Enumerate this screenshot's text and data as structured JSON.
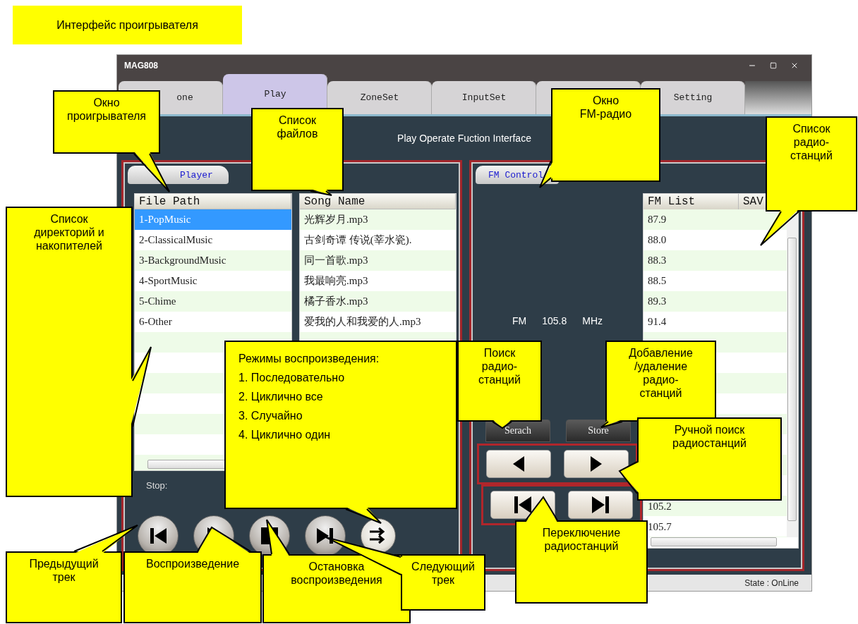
{
  "caption": "Интерфейс проигрывателя",
  "window": {
    "title": "MAG808"
  },
  "tabs": [
    {
      "label": "one",
      "selected": false
    },
    {
      "label": "Play",
      "selected": true
    },
    {
      "label": "ZoneSet",
      "selected": false
    },
    {
      "label": "InputSet",
      "selected": false
    },
    {
      "selected": false
    },
    {
      "label": "Setting",
      "selected": false
    }
  ],
  "page_title": "Play Operate Fuction Interface",
  "player": {
    "tab": "Player",
    "folders": {
      "header": "File Path",
      "items": [
        {
          "label": "1-PopMusic",
          "selected": true
        },
        {
          "label": "2-ClassicalMusic",
          "selected": false
        },
        {
          "label": "3-BackgroundMusic",
          "selected": false
        },
        {
          "label": "4-SportMusic",
          "selected": false
        },
        {
          "label": "5-Chime",
          "selected": false
        },
        {
          "label": "6-Other",
          "selected": false
        }
      ]
    },
    "songs": {
      "header": "Song Name",
      "items": [
        "光辉岁月.mp3",
        "古剑奇谭 传说(莘水瓷).",
        "同一首歌.mp3",
        "我最响亮.mp3",
        "橘子香水.mp3",
        "爱我的人和我爱的人.mp3"
      ]
    },
    "status": "Stop:",
    "controls": [
      {
        "kind": "previous"
      },
      {
        "kind": "play"
      },
      {
        "kind": "stop"
      },
      {
        "kind": "next"
      },
      {
        "kind": "mode"
      }
    ]
  },
  "fm": {
    "tab": "FM Control",
    "band": "FM",
    "frequency": "105.8",
    "unit": "MHz",
    "list": {
      "columns": [
        "FM List",
        "SAV"
      ],
      "rows": [
        "87.9",
        "88.0",
        "88.3",
        "88.5",
        "89.3",
        "91.4"
      ],
      "rows_lower": [
        "105.2",
        "105.7"
      ]
    },
    "buttons": [
      "Serach",
      "Store"
    ],
    "tune": [
      {
        "kind": "left"
      },
      {
        "kind": "right"
      }
    ],
    "switch": [
      {
        "kind": "previous"
      },
      {
        "kind": "next"
      }
    ]
  },
  "status_bar": {
    "state": "State : OnLine"
  },
  "callouts": [
    {
      "text": "Окно\nпроигрывателя"
    },
    {
      "text": "Список\nфайлов"
    },
    {
      "text": "Окно\nFM-радио"
    },
    {
      "text": "Список\nрадио-\nстанций"
    },
    {
      "text": "Список\nдиректорий и\nнакопителей"
    },
    {
      "text": "Режимы воспроизведения:\n1. Последовательно\n2. Циклично все\n3. Случайно\n4. Циклично один",
      "kind": "list"
    },
    {
      "text": "Поиск\nрадио-\nстанций"
    },
    {
      "text": "Добавление\n/удаление\nрадио-\nстанций"
    },
    {
      "text": "Ручной поиск\nрадиостанций"
    },
    {
      "text": "Переключение\nрадиостанций"
    },
    {
      "text": "Предыдущий\nтрек"
    },
    {
      "text": "Воспроизведение"
    },
    {
      "text": "Остановка\nвоспроизведения"
    },
    {
      "text": "Следующий\nтрек"
    }
  ]
}
